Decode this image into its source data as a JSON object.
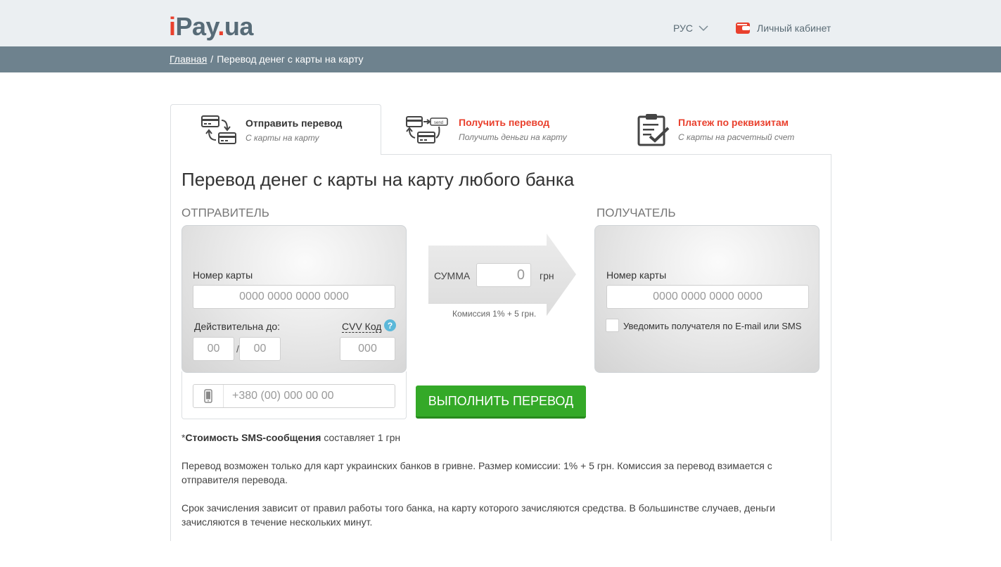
{
  "header": {
    "logo_i": "i",
    "logo_pay": "Pay",
    "logo_dot": ".",
    "logo_ua": "ua",
    "lang": "РУС",
    "cabinet": "Личный кабинет"
  },
  "breadcrumb": {
    "home": "Главная",
    "separator": "/",
    "current": "Перевод денег с карты на карту"
  },
  "tabs": [
    {
      "title": "Отправить перевод",
      "subtitle": "С карты на карту",
      "active": true
    },
    {
      "title": "Получить перевод",
      "subtitle": "Получить деньги на карту",
      "active": false
    },
    {
      "title": "Платеж по реквизитам",
      "subtitle": "С карты на расчетный счет",
      "active": false
    }
  ],
  "page_title": "Перевод денег с карты на карту любого банка",
  "sender": {
    "heading": "ОТПРАВИТЕЛЬ",
    "card_label": "Номер карты",
    "card_placeholder": "0000 0000 0000 0000",
    "valid_label": "Действительна до:",
    "month_placeholder": "00",
    "date_sep": "/",
    "year_placeholder": "00",
    "cvv_label": "CVV Код",
    "cvv_placeholder": "000",
    "phone_placeholder": "+380 (00) 000 00 00"
  },
  "transfer": {
    "sum_label": "СУММА",
    "sum_value": "0",
    "currency": "грн",
    "commission": "Комиссия 1% + 5 грн.",
    "submit_label": "ВЫПОЛНИТЬ ПЕРЕВОД"
  },
  "recipient": {
    "heading": "ПОЛУЧАТЕЛЬ",
    "card_label": "Номер карты",
    "card_placeholder": "0000 0000 0000 0000",
    "notify_label": "Уведомить получателя по E-mail или SMS"
  },
  "notes": {
    "sms_prefix": "*",
    "sms_bold": "Стоимость SMS-сообщения",
    "sms_rest": " составляет 1 грн",
    "para1": "Перевод возможен только для карт украинских банков в гривне. Размер комиссии: 1% + 5 грн. Комиссия за перевод взимается с отправителя перевода.",
    "para2": "Срок зачисления зависит от правил работы того банка, на карту которого зачисляются средства. В большинстве случаев, деньги зачисляются в течение нескольких минут."
  },
  "colors": {
    "brand_red": "#e9402d",
    "header_bg": "#ebeff2",
    "crumb_bg": "#6e828e",
    "button_green": "#34a928"
  },
  "icons": {
    "lang": "chevron-down-icon",
    "cabinet": "wallet-icon",
    "tab_send": "card-transfer-icon",
    "tab_receive": "card-receive-icon",
    "tab_requisites": "clipboard-check-icon",
    "cvv_help": "question-icon",
    "phone": "mobile-phone-icon"
  }
}
